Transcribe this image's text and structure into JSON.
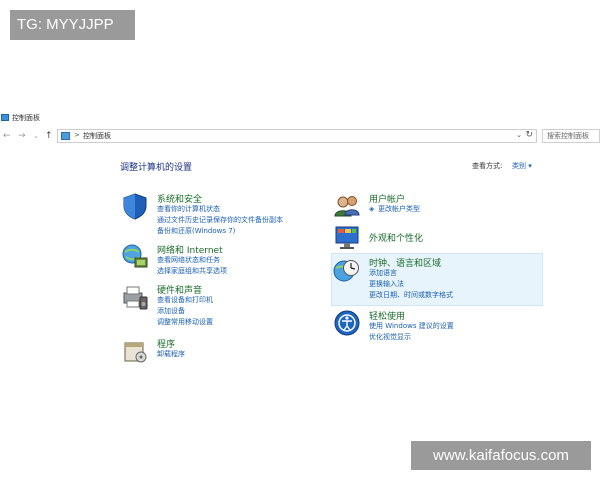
{
  "watermarks": {
    "top": "TG: MYYJJPP",
    "bottom": "www.kaifafocus.com"
  },
  "window": {
    "title": "控制面板"
  },
  "nav": {
    "back": "←",
    "forward": "→",
    "recent": "⌄",
    "up": "↑",
    "breadcrumb_sep": ">",
    "breadcrumb": "控制面板",
    "dropdown": "⌄",
    "refresh": "↻",
    "search_placeholder": "搜索控制面板"
  },
  "main": {
    "title": "调整计算机的设置",
    "view_by_label": "查看方式:",
    "view_by_value": "类别 ▾"
  },
  "left": [
    {
      "heading": "系统和安全",
      "icon": "shield-icon",
      "links": [
        "查看你的计算机状态",
        "通过文件历史记录保存你的文件备份副本",
        "备份和还原(Windows 7)"
      ]
    },
    {
      "heading": "网络和 Internet",
      "icon": "network-globe-icon",
      "links": [
        "查看网络状态和任务",
        "选择家庭组和共享选项"
      ]
    },
    {
      "heading": "硬件和声音",
      "icon": "printer-speaker-icon",
      "links": [
        "查看设备和打印机",
        "添加设备",
        "调整常用移动设置"
      ]
    },
    {
      "heading": "程序",
      "icon": "programs-icon",
      "links": [
        "卸载程序"
      ]
    }
  ],
  "right": [
    {
      "heading": "用户帐户",
      "icon": "users-icon",
      "links": [
        "更改帐户类型"
      ]
    },
    {
      "heading": "外观和个性化",
      "icon": "monitor-appearance-icon",
      "links": []
    },
    {
      "heading": "时钟、语言和区域",
      "icon": "clock-globe-icon",
      "links": [
        "添加语言",
        "更换输入法",
        "更改日期、时间或数字格式"
      ]
    },
    {
      "heading": "轻松使用",
      "icon": "ease-of-access-icon",
      "links": [
        "使用 Windows 建议的设置",
        "优化视觉显示"
      ]
    }
  ]
}
